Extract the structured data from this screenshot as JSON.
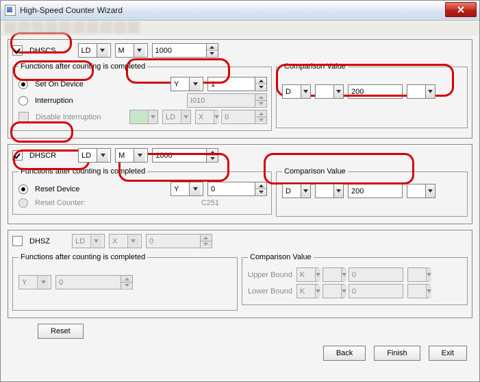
{
  "window": {
    "title": "High-Speed Counter Wizard"
  },
  "dhscs": {
    "label": "DHSCS",
    "checked": true,
    "prefix1": "LD",
    "prefix2": "M",
    "value": "1000",
    "functions_legend": "Functions after counting is completed",
    "setOn": {
      "label": "Set On Device",
      "checked": true,
      "dev": "Y",
      "num": "1"
    },
    "interrupt": {
      "label": "Interruption",
      "checked": false,
      "code": "I010"
    },
    "disable": {
      "label": "Disable Interruption",
      "checked": false,
      "p1": "LD",
      "p2": "X",
      "num": "0"
    },
    "compare_legend": "Comparison Value",
    "compare": {
      "dev": "D",
      "mid": "",
      "num": "200",
      "trail": ""
    }
  },
  "dhscr": {
    "label": "DHSCR",
    "checked": true,
    "prefix1": "LD",
    "prefix2": "M",
    "value": "1000",
    "functions_legend": "Functions after counting is completed",
    "resetDev": {
      "label": "Reset Device",
      "checked": true,
      "dev": "Y",
      "num": "0"
    },
    "resetCnt": {
      "label": "Reset Counter:",
      "checked": false,
      "value": "C251"
    },
    "compare_legend": "Comparison Value",
    "compare": {
      "dev": "D",
      "mid": "",
      "num": "200",
      "trail": ""
    }
  },
  "dhsz": {
    "label": "DHSZ",
    "checked": false,
    "prefix1": "LD",
    "prefix2": "X",
    "value": "0",
    "functions_legend": "Functions after counting is completed",
    "out": {
      "dev": "Y",
      "num": "0"
    },
    "compare_legend": "Comparison Value",
    "upper": {
      "label": "Upper Bound",
      "dev": "K",
      "mid": "",
      "num": "0",
      "trail": ""
    },
    "lower": {
      "label": "Lower Bound",
      "dev": "K",
      "mid": "",
      "num": "0",
      "trail": ""
    }
  },
  "buttons": {
    "reset": "Reset",
    "back": "Back",
    "finish": "Finish",
    "exit": "Exit"
  }
}
